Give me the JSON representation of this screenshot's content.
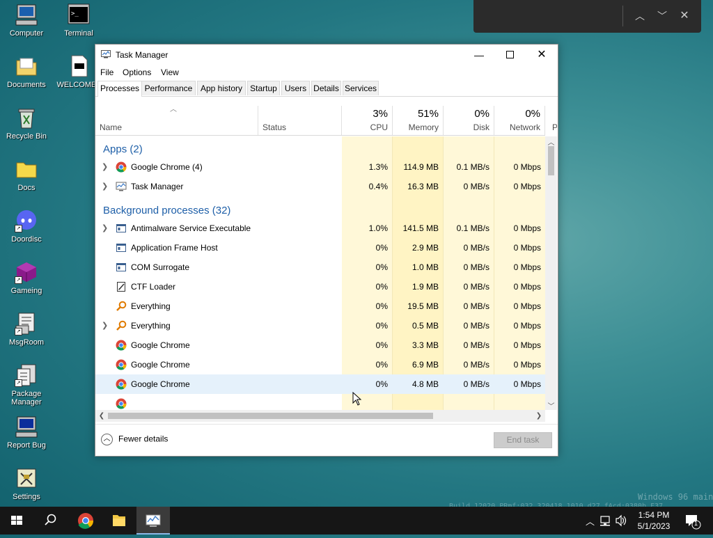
{
  "desktop": {
    "icons": [
      {
        "label": "Computer"
      },
      {
        "label": "Terminal"
      },
      {
        "label": "Documents"
      },
      {
        "label": "WELCOME.."
      },
      {
        "label": "Recycle Bin"
      },
      {
        "label": "Docs"
      },
      {
        "label": "Doordisc"
      },
      {
        "label": "Gameing"
      },
      {
        "label": "MsgRoom"
      },
      {
        "label": "Package Manager"
      },
      {
        "label": "Report Bug"
      },
      {
        "label": "Settings"
      }
    ]
  },
  "window": {
    "title": "Task Manager",
    "menu": [
      "File",
      "Options",
      "View"
    ],
    "tabs": [
      "Processes",
      "Performance",
      "App history",
      "Startup",
      "Users",
      "Details",
      "Services"
    ],
    "active_tab": "Processes",
    "columns": {
      "name": "Name",
      "status": "Status",
      "cpu": {
        "pct": "3%",
        "label": "CPU"
      },
      "memory": {
        "pct": "51%",
        "label": "Memory"
      },
      "disk": {
        "pct": "0%",
        "label": "Disk"
      },
      "network": {
        "pct": "0%",
        "label": "Network"
      },
      "power": {
        "label": "P"
      }
    },
    "groups": {
      "apps": "Apps (2)",
      "background": "Background processes (32)"
    },
    "apps": [
      {
        "name": "Google Chrome (4)",
        "cpu": "1.3%",
        "mem": "114.9 MB",
        "disk": "0.1 MB/s",
        "net": "0 Mbps",
        "icon": "chrome-icon",
        "expandable": true
      },
      {
        "name": "Task Manager",
        "cpu": "0.4%",
        "mem": "16.3 MB",
        "disk": "0 MB/s",
        "net": "0 Mbps",
        "icon": "task-manager-icon",
        "expandable": true
      }
    ],
    "background": [
      {
        "name": "Antimalware Service Executable",
        "cpu": "1.0%",
        "mem": "141.5 MB",
        "disk": "0.1 MB/s",
        "net": "0 Mbps",
        "icon": "service-icon",
        "expandable": true
      },
      {
        "name": "Application Frame Host",
        "cpu": "0%",
        "mem": "2.9 MB",
        "disk": "0 MB/s",
        "net": "0 Mbps",
        "icon": "service-icon",
        "expandable": false
      },
      {
        "name": "COM Surrogate",
        "cpu": "0%",
        "mem": "1.0 MB",
        "disk": "0 MB/s",
        "net": "0 Mbps",
        "icon": "service-icon",
        "expandable": false
      },
      {
        "name": "CTF Loader",
        "cpu": "0%",
        "mem": "1.9 MB",
        "disk": "0 MB/s",
        "net": "0 Mbps",
        "icon": "ctf-loader-icon",
        "expandable": false
      },
      {
        "name": "Everything",
        "cpu": "0%",
        "mem": "19.5 MB",
        "disk": "0 MB/s",
        "net": "0 Mbps",
        "icon": "magnifier-icon",
        "expandable": false
      },
      {
        "name": "Everything",
        "cpu": "0%",
        "mem": "0.5 MB",
        "disk": "0 MB/s",
        "net": "0 Mbps",
        "icon": "magnifier-icon",
        "expandable": true
      },
      {
        "name": "Google Chrome",
        "cpu": "0%",
        "mem": "3.3 MB",
        "disk": "0 MB/s",
        "net": "0 Mbps",
        "icon": "chrome-icon",
        "expandable": false
      },
      {
        "name": "Google Chrome",
        "cpu": "0%",
        "mem": "6.9 MB",
        "disk": "0 MB/s",
        "net": "0 Mbps",
        "icon": "chrome-icon",
        "expandable": false
      },
      {
        "name": "Google Chrome",
        "cpu": "0%",
        "mem": "4.8 MB",
        "disk": "0 MB/s",
        "net": "0 Mbps",
        "icon": "chrome-icon",
        "expandable": false,
        "selected": true
      }
    ],
    "footer": {
      "fewer_details": "Fewer details",
      "end_task": "End task"
    }
  },
  "watermark": {
    "line1": "Windows 96 main",
    "line2": "Build 12020 PRmf:032.320418.1010.d27_fAcd:0380b_F37"
  },
  "taskbar": {
    "clock_time": "1:54 PM",
    "clock_date": "5/1/2023",
    "notification_count": "1"
  },
  "colors": {
    "accent_blue": "#1e5fa8",
    "heat_light": "#fff4c4",
    "heat_med": "#ffefb0",
    "heat_strong": "#fde9a0",
    "taskbar": "#161616"
  }
}
